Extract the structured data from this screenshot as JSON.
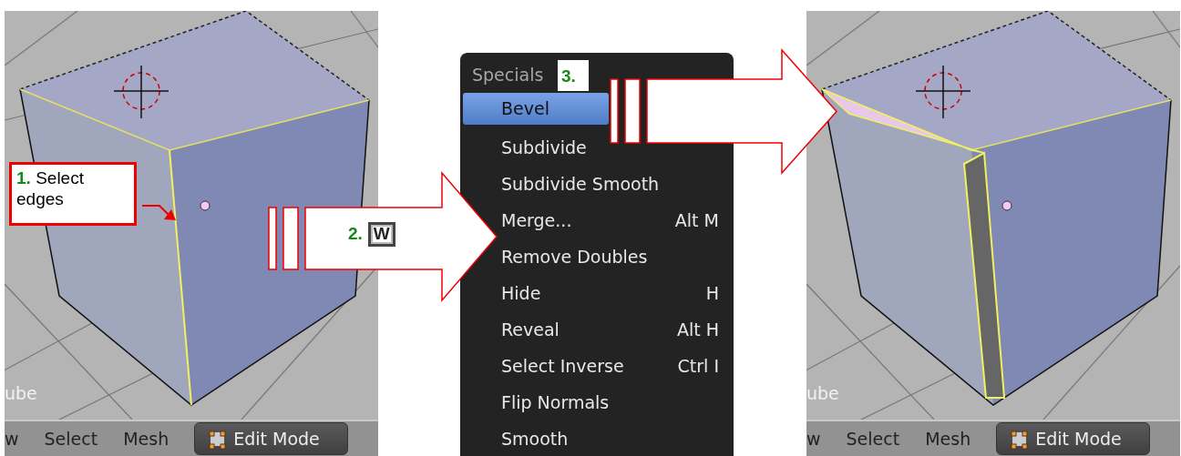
{
  "viewports": [
    {
      "object_label": "ube",
      "header_items": [
        "w",
        "Select",
        "Mesh"
      ],
      "mode": "Edit Mode",
      "beveled": false
    },
    {
      "object_label": "ube",
      "header_items": [
        "w",
        "Select",
        "Mesh"
      ],
      "mode": "Edit Mode",
      "beveled": true
    }
  ],
  "menu": {
    "title": "Specials",
    "items": [
      {
        "label": "Bevel",
        "selected": true
      },
      {
        "label": "Subdivide",
        "selected": false
      },
      {
        "label": "Subdivide Smooth",
        "selected": false
      },
      {
        "label": "Merge...",
        "shortcut": "Alt M",
        "selected": false
      },
      {
        "label": "Remove Doubles",
        "selected": false
      },
      {
        "label": "Hide",
        "shortcut": "H",
        "selected": false
      },
      {
        "label": "Reveal",
        "shortcut": "Alt H",
        "selected": false
      },
      {
        "label": "Select Inverse",
        "shortcut": "Ctrl I",
        "selected": false
      },
      {
        "label": "Flip Normals",
        "selected": false
      },
      {
        "label": "Smooth",
        "selected": false
      }
    ]
  },
  "steps": [
    {
      "number": "1.",
      "text": "Select edges"
    },
    {
      "number": "2.",
      "key": "W"
    },
    {
      "number": "3."
    }
  ]
}
